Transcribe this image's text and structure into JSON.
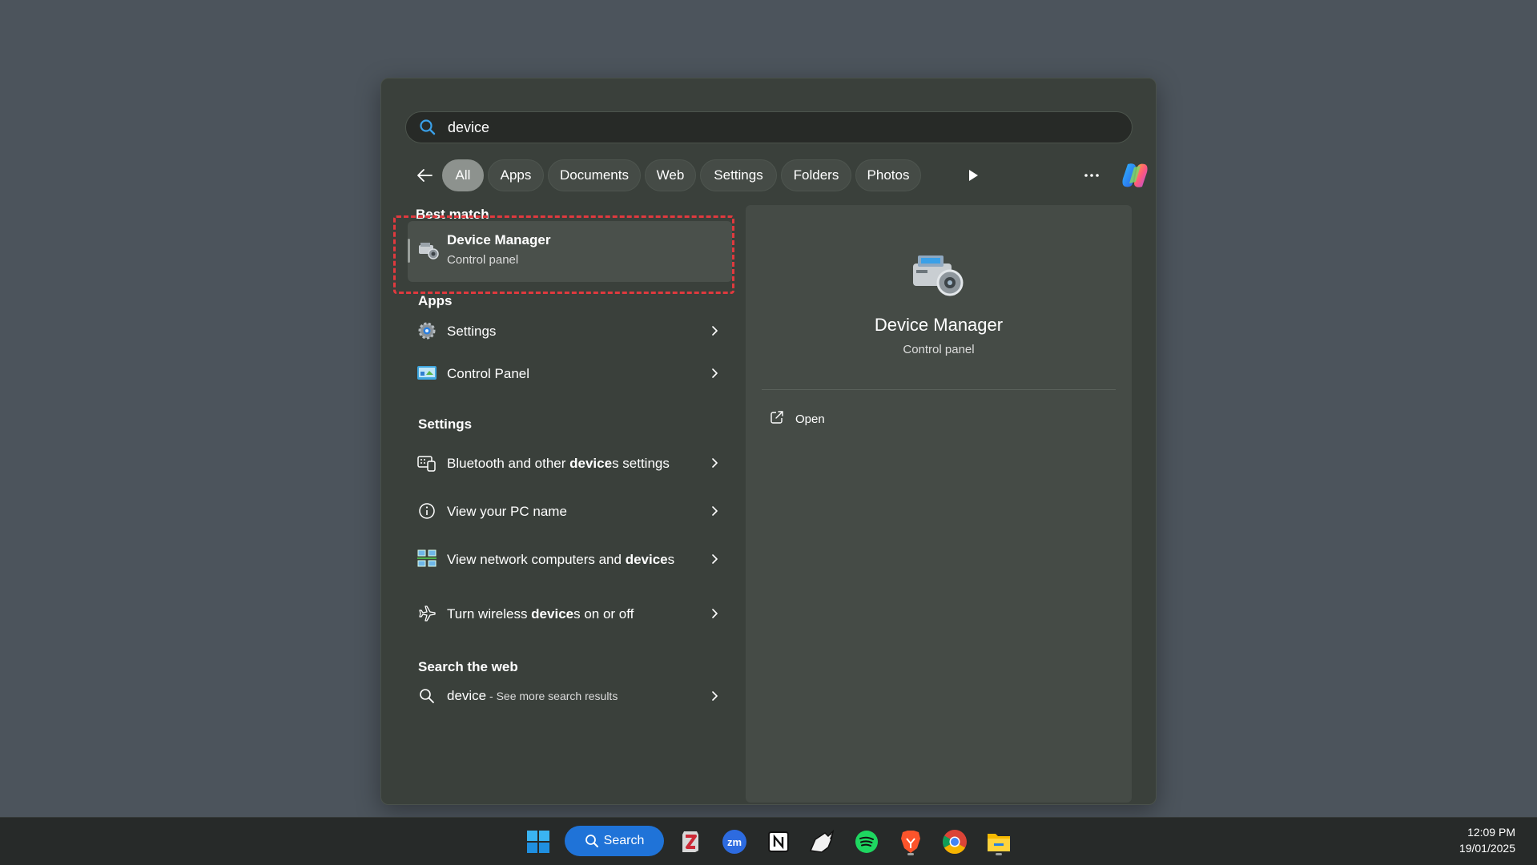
{
  "search": {
    "query": "device"
  },
  "filters": {
    "chips": [
      "All",
      "Apps",
      "Documents",
      "Web",
      "Settings",
      "Folders",
      "Photos"
    ],
    "active": "All"
  },
  "sections": {
    "best_match": "Best match",
    "apps": "Apps",
    "settings": "Settings",
    "search_web": "Search the web"
  },
  "best_match": {
    "title": "Device Manager",
    "subtitle": "Control panel"
  },
  "apps": [
    {
      "label": "Settings",
      "icon": "settings-gear-icon"
    },
    {
      "label": "Control Panel",
      "icon": "control-panel-icon"
    }
  ],
  "settings_items": [
    {
      "pre": "Bluetooth and other ",
      "bold": "device",
      "post": "s settings",
      "icon": "keyboard-devices-icon"
    },
    {
      "pre": "View your PC name",
      "bold": "",
      "post": "",
      "icon": "info-icon"
    },
    {
      "pre": "View network computers and ",
      "bold": "device",
      "post": "s",
      "icon": "network-computers-icon"
    },
    {
      "pre": "Turn wireless ",
      "bold": "device",
      "post": "s on or off",
      "icon": "airplane-icon"
    }
  ],
  "web": {
    "query": "device",
    "suffix": " - See more search results"
  },
  "preview": {
    "title": "Device Manager",
    "subtitle": "Control panel",
    "action_open": "Open"
  },
  "taskbar": {
    "search_label": "Search",
    "time": "12:09 PM",
    "date": "19/01/2025",
    "apps": [
      "windows-start-icon",
      "zotero-icon",
      "zoom-icon",
      "notion-icon",
      "rhino-icon",
      "spotify-icon",
      "brave-icon",
      "chrome-icon",
      "file-explorer-icon"
    ]
  },
  "colors": {
    "accent": "#1f73d8",
    "highlight": "#e0393e",
    "panel": "#3a403b"
  }
}
